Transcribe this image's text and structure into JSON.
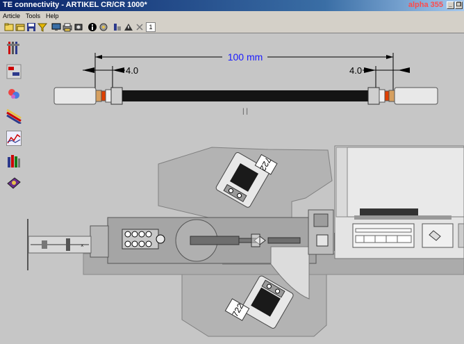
{
  "window": {
    "title": "TE connectivity - ARTIKEL CR/CR 1000*",
    "system_label": "alpha 355"
  },
  "menu": {
    "items": [
      "Article",
      "Tools",
      "Help"
    ]
  },
  "toolbar": {
    "zoom_value": "1"
  },
  "drawing": {
    "total_length": "100 mm",
    "left_strip": "4.0",
    "right_strip": "4.0",
    "center_mark": "| |",
    "upper_applicator_label": "722",
    "lower_applicator_label": "722"
  },
  "colors": {
    "title_start": "#0a246a",
    "title_end": "#a6caf0",
    "dimension_text": "#1a1aff",
    "machine_gray": "#a8a8a8",
    "background": "#c6c6c6"
  }
}
